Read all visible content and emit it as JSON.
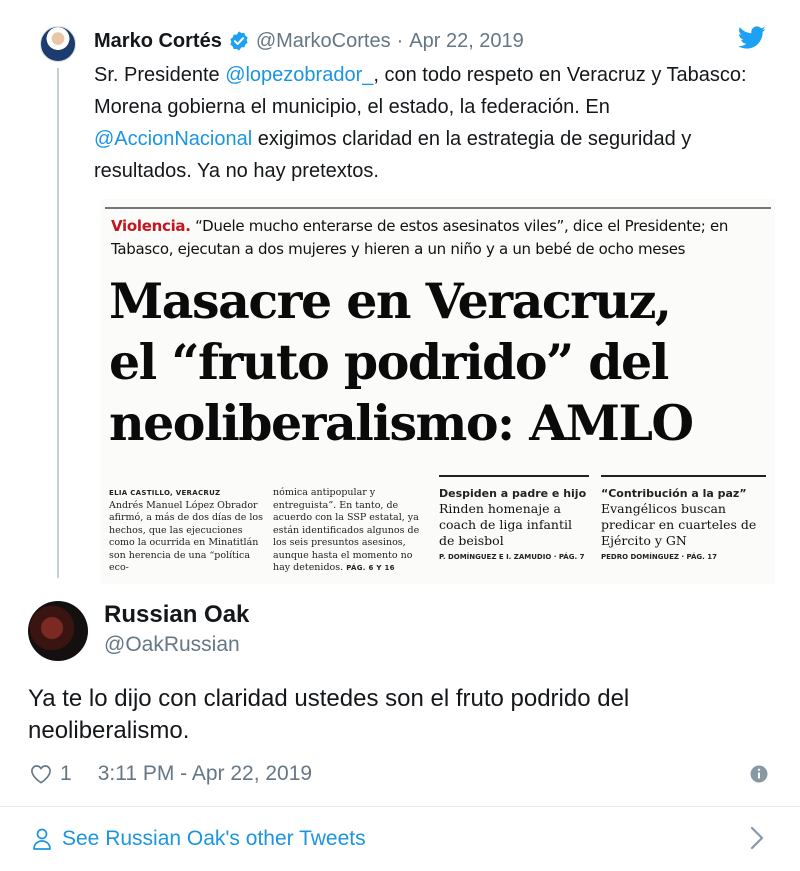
{
  "quoted_tweet": {
    "name": "Marko Cortés",
    "handle": "@MarkoCortes",
    "separator": "·",
    "date": "Apr 22, 2019",
    "text_1": "Sr. Presidente ",
    "mention_1": "@lopezobrador_",
    "text_2": ", con todo respeto en Veracruz y Tabasco: Morena gobierna el municipio, el estado, la federación. En ",
    "mention_2": "@AccionNacional",
    "text_3": " exigimos claridad en la estrategia de seguridad y resultados. Ya no hay pretextos."
  },
  "newspaper": {
    "kicker_label": "Violencia.",
    "kicker_text": " “Duele mucho enterarse de estos asesinatos viles”, dice el Presidente; en Tabasco, ejecutan a dos mujeres y hieren a un niño y a un bebé de ocho meses",
    "headline_1": "Masacre en Veracruz,",
    "headline_2": "el “fruto podrido” del",
    "headline_3": "neoliberalismo: AMLO",
    "byline": "ELIA CASTILLO, VERACRUZ",
    "col1": "Andrés Manuel López Obrador afirmó, a más de dos días de los hechos, que las ejecuciones como la ocurrida en Minatitlán son herencia de una “política eco-",
    "col2": "nómica antipopular y entreguista”. En tanto, de acuerdo con la SSP estatal, ya están identificados algunos de los seis presuntos asesinos, aunque hasta el momento no hay detenidos.",
    "col2_page": "PÁG. 6 Y 16",
    "col3_title": "Despiden a padre e hijo",
    "col3_text": "Rinden homenaje a coach de liga infantil de beisbol",
    "col3_foot": "P. DOMÍNGUEZ E I. ZAMUDIO · PÁG. 7",
    "col4_title": "“Contribución a la paz”",
    "col4_text": "Evangélicos buscan predicar en cuarteles de Ejército y GN",
    "col4_foot": "PEDRO DOMÍNGUEZ · PÁG. 17"
  },
  "reply": {
    "name": "Russian Oak",
    "handle": "@OakRussian",
    "text": "Ya te lo dijo con claridad ustedes son el fruto podrido del neoliberalismo.",
    "like_count": "1",
    "timestamp": "3:11 PM - Apr 22, 2019"
  },
  "footer": {
    "label": "See Russian Oak's other Tweets"
  },
  "icons": {
    "verified": "verified-badge-icon",
    "bird": "twitter-bird-icon",
    "heart": "heart-icon",
    "info": "info-icon",
    "person": "person-icon",
    "chevron": "chevron-right-icon"
  },
  "colors": {
    "link": "#1b95e0",
    "secondary_text": "#657786",
    "kicker_red": "#c3161c"
  }
}
